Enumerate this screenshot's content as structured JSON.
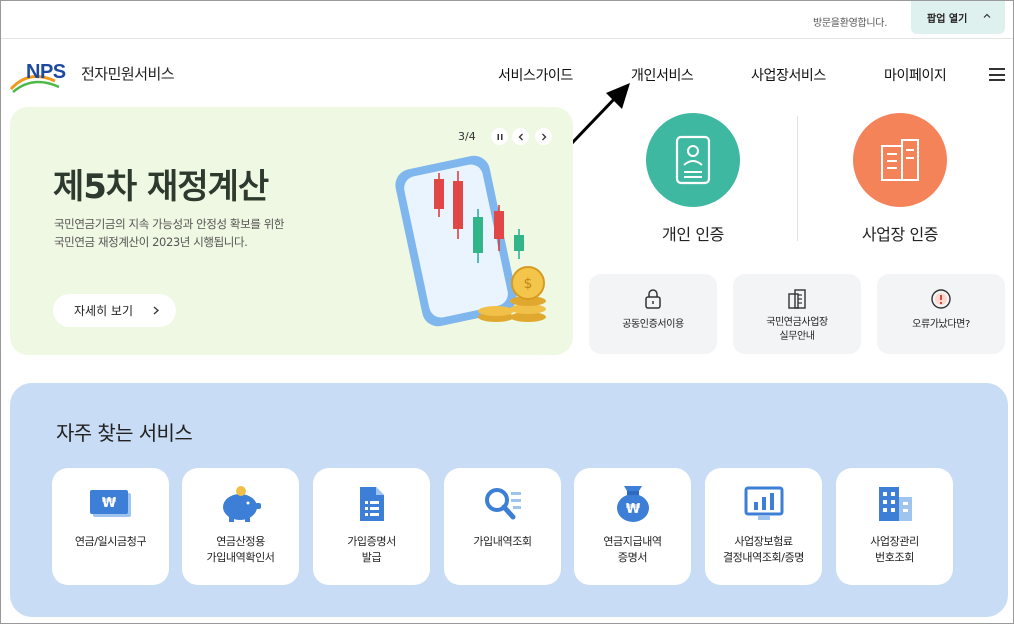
{
  "topbar": {
    "welcome_text": "방문을환영합니다.",
    "popup_label": "팝업 열기"
  },
  "header": {
    "logo_letters": "NPS",
    "logo_text": "전자민원서비스",
    "nav": [
      {
        "label": "서비스가이드"
      },
      {
        "label": "개인서비스"
      },
      {
        "label": "사업장서비스"
      },
      {
        "label": "마이페이지"
      }
    ]
  },
  "banner": {
    "title": "제5차 재정계산",
    "desc_line1": "국민연금기금의 지속 가능성과 안정성 확보를 위한",
    "desc_line2": "국민연금 재정계산이 2023년 시행됩니다.",
    "detail_label": "자세히 보기",
    "pager": "3/4"
  },
  "certs": [
    {
      "label": "개인 인증",
      "icon": "id-card-icon",
      "color": "#3fb8a1"
    },
    {
      "label": "사업장 인증",
      "icon": "building-icon",
      "color": "#f5835a"
    }
  ],
  "quick_cards": [
    {
      "label": "공동인증서이용",
      "icon": "lock-icon"
    },
    {
      "label_line1": "국민연금사업장",
      "label_line2": "실무안내",
      "icon": "document-building-icon"
    },
    {
      "label": "오류가났다면?",
      "icon": "alert-icon"
    }
  ],
  "freq": {
    "title": "자주 찾는 서비스",
    "services": [
      {
        "line1": "연금/일시금청구",
        "line2": "",
        "icon": "won-card-icon"
      },
      {
        "line1": "연금산정용",
        "line2": "가입내역확인서",
        "icon": "piggy-bank-icon"
      },
      {
        "line1": "가입증명서",
        "line2": "발급",
        "icon": "document-icon"
      },
      {
        "line1": "가입내역조회",
        "line2": "",
        "icon": "search-list-icon"
      },
      {
        "line1": "연금지급내역",
        "line2": "증명서",
        "icon": "money-bag-icon"
      },
      {
        "line1": "사업장보험료",
        "line2": "결정내역조회/증명",
        "icon": "monitor-chart-icon"
      },
      {
        "line1": "사업장관리",
        "line2": "번호조회",
        "icon": "office-building-icon"
      }
    ]
  },
  "colors": {
    "accent_teal": "#3fb8a1",
    "accent_orange": "#f5835a",
    "banner_bg": "#eff8e2",
    "freq_bg": "#c8ddf5"
  }
}
